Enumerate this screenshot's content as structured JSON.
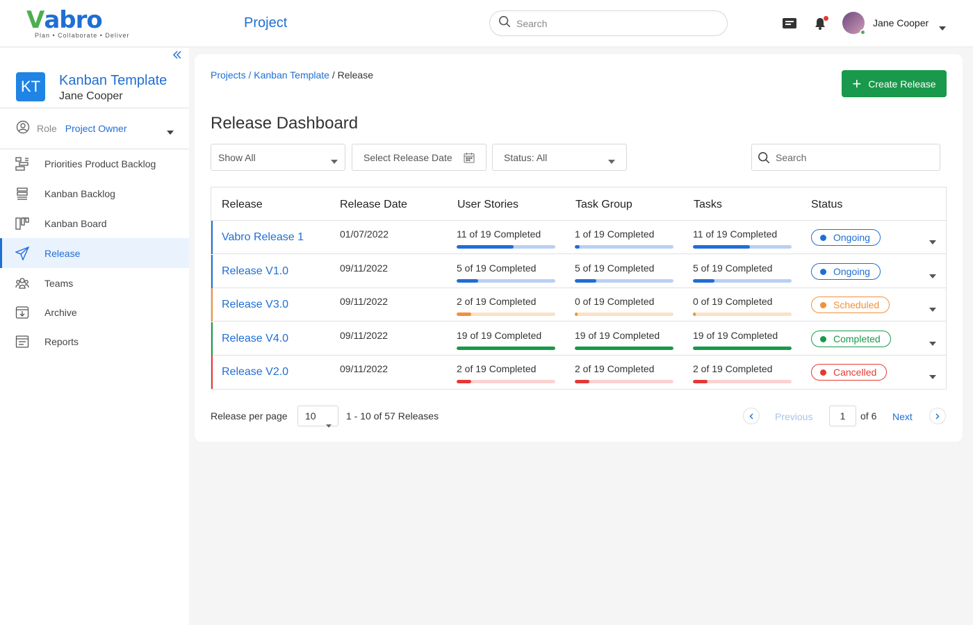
{
  "header": {
    "logo_text": "abro",
    "logo_v": "V",
    "logo_tagline": "Plan • Collaborate • Deliver",
    "title": "Project",
    "search_placeholder": "Search",
    "user_name": "Jane Cooper"
  },
  "sidebar": {
    "project_initials": "KT",
    "project_name": "Kanban Template",
    "project_owner": "Jane Cooper",
    "role_label": "Role",
    "role_value": "Project Owner",
    "items": [
      {
        "label": "Priorities Product Backlog",
        "icon": "backlog-priority-icon"
      },
      {
        "label": "Kanban Backlog",
        "icon": "list-icon"
      },
      {
        "label": "Kanban Board",
        "icon": "board-icon"
      },
      {
        "label": "Release",
        "icon": "paper-plane-icon",
        "active": true
      },
      {
        "label": "Teams",
        "icon": "team-icon"
      },
      {
        "label": "Archive",
        "icon": "archive-icon"
      },
      {
        "label": "Reports",
        "icon": "report-icon"
      }
    ]
  },
  "main": {
    "breadcrumb": {
      "projects": "Projects",
      "sep1": " / ",
      "template": "Kanban Template",
      "sep2": " / ",
      "current": "Release"
    },
    "create_button": "Create Release",
    "title": "Release Dashboard",
    "filters": {
      "show": "Show All",
      "date": "Select Release Date",
      "status": "Status: All",
      "search_placeholder": "Search"
    },
    "columns": [
      "Release",
      "Release Date",
      "User Stories",
      "Task Group",
      "Tasks",
      "Status"
    ],
    "rows": [
      {
        "name": "Vabro Release 1",
        "date": "01/07/2022",
        "stories": {
          "text": "11 of 19 Completed",
          "pct": 0.58
        },
        "taskgroup": {
          "text": "1 of 19 Completed",
          "pct": 0.05
        },
        "tasks": {
          "text": "11 of 19 Completed",
          "pct": 0.58
        },
        "status": "Ongoing",
        "color": "#1f6ed4",
        "track": "#b9d0f3",
        "pillbg": "#ffffff"
      },
      {
        "name": "Release V1.0",
        "date": "09/11/2022",
        "stories": {
          "text": "5 of 19 Completed",
          "pct": 0.22
        },
        "taskgroup": {
          "text": "5 of 19 Completed",
          "pct": 0.22
        },
        "tasks": {
          "text": "5 of 19 Completed",
          "pct": 0.22
        },
        "status": "Ongoing",
        "color": "#1f6ed4",
        "track": "#b9d0f3",
        "pillbg": "#ffffff"
      },
      {
        "name": "Release V3.0",
        "date": "09/11/2022",
        "stories": {
          "text": "2 of 19 Completed",
          "pct": 0.15
        },
        "taskgroup": {
          "text": "0 of 19 Completed",
          "pct": 0.03
        },
        "tasks": {
          "text": "0 of 19 Completed",
          "pct": 0.03
        },
        "status": "Scheduled",
        "color": "#f0913a",
        "track": "#fbe1c8",
        "pillbg": "#ffffff"
      },
      {
        "name": "Release V4.0",
        "date": "09/11/2022",
        "stories": {
          "text": "19 of 19 Completed",
          "pct": 1.0
        },
        "taskgroup": {
          "text": "19 of 19 Completed",
          "pct": 1.0
        },
        "tasks": {
          "text": "19 of 19 Completed",
          "pct": 1.0
        },
        "status": "Completed",
        "color": "#19994b",
        "track": "#c4e8d1",
        "pillbg": "#ffffff"
      },
      {
        "name": "Release V2.0",
        "date": "09/11/2022",
        "stories": {
          "text": "2 of 19 Completed",
          "pct": 0.15
        },
        "taskgroup": {
          "text": "2 of 19 Completed",
          "pct": 0.15
        },
        "tasks": {
          "text": "2 of 19 Completed",
          "pct": 0.15
        },
        "status": "Cancelled",
        "color": "#e53935",
        "track": "#fbd3d2",
        "pillbg": "#ffffff"
      }
    ],
    "pagination": {
      "per_page_label": "Release per page",
      "per_page": "10",
      "range": "1 - 10 of 57 Releases",
      "previous": "Previous",
      "current_page": "1",
      "of_pages": "of 6",
      "next": "Next"
    }
  }
}
